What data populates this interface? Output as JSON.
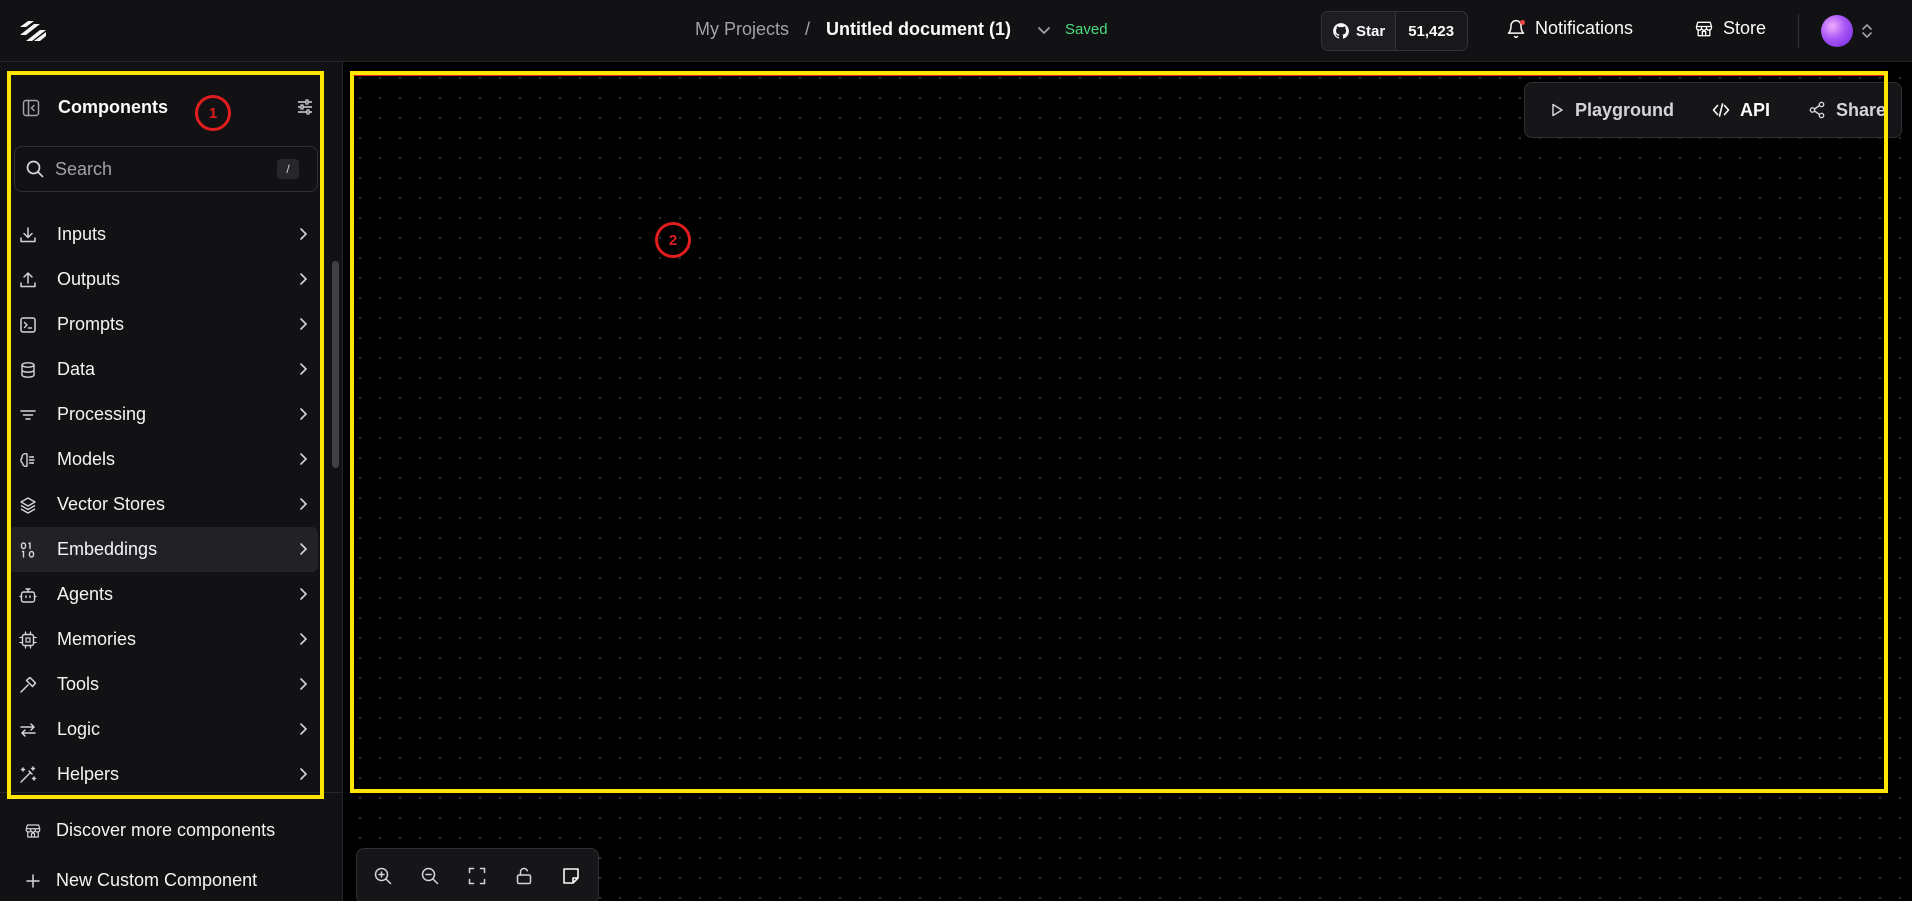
{
  "header": {
    "breadcrumb_project": "My Projects",
    "breadcrumb_separator": "/",
    "document_title": "Untitled document (1)",
    "save_status": "Saved",
    "github_star_label": "Star",
    "github_star_count": "51,423",
    "notifications_label": "Notifications",
    "store_label": "Store"
  },
  "sidebar": {
    "title": "Components",
    "search_placeholder": "Search",
    "search_shortcut": "/",
    "categories": [
      {
        "label": "Inputs",
        "icon": "download-icon"
      },
      {
        "label": "Outputs",
        "icon": "upload-icon"
      },
      {
        "label": "Prompts",
        "icon": "terminal-square-icon"
      },
      {
        "label": "Data",
        "icon": "database-icon"
      },
      {
        "label": "Processing",
        "icon": "filter-lines-icon"
      },
      {
        "label": "Models",
        "icon": "brain-icon"
      },
      {
        "label": "Vector Stores",
        "icon": "layers-icon"
      },
      {
        "label": "Embeddings",
        "icon": "binary-icon",
        "active": true
      },
      {
        "label": "Agents",
        "icon": "bot-icon"
      },
      {
        "label": "Memories",
        "icon": "cpu-icon"
      },
      {
        "label": "Tools",
        "icon": "hammer-icon"
      },
      {
        "label": "Logic",
        "icon": "arrows-swap-icon"
      },
      {
        "label": "Helpers",
        "icon": "wand-icon"
      }
    ],
    "footer_discover": "Discover more components",
    "footer_new_custom": "New Custom Component"
  },
  "canvas_toolbar": {
    "playground_label": "Playground",
    "api_label": "API",
    "share_label": "Share"
  },
  "zoom_controls": [
    "zoom-in-icon",
    "zoom-out-icon",
    "fit-view-icon",
    "lock-open-icon",
    "sticky-note-icon"
  ],
  "annotations": {
    "marker_1": "1",
    "marker_2": "2",
    "highlight_color": "#ffe600",
    "marker_color": "#e11d1d"
  },
  "colors": {
    "saved": "#4ade80",
    "notification_dot": "#ef4444",
    "background": "#000000",
    "panel": "#121214"
  }
}
